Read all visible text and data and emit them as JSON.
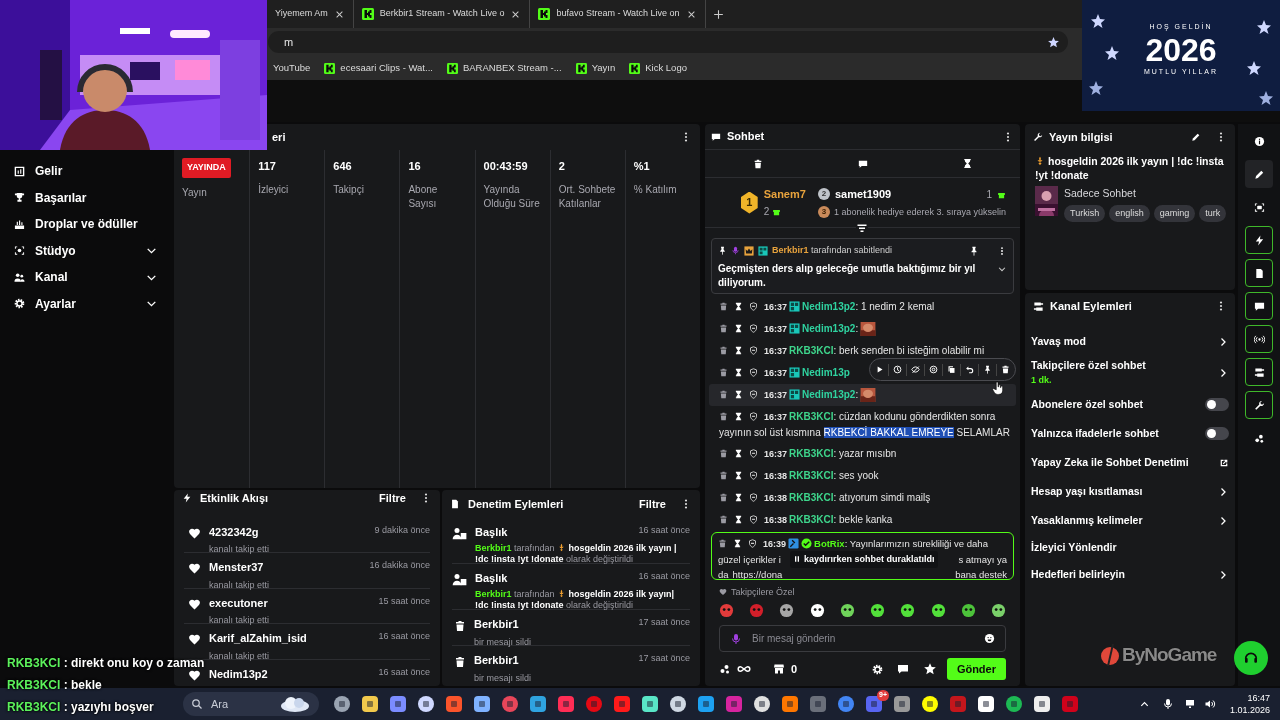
{
  "browser": {
    "tabs": [
      {
        "label": "Yiyemem Am"
      },
      {
        "label": "Berkbir1 Stream - Watch Live o"
      },
      {
        "label": "bufavo Stream - Watch Live on"
      }
    ],
    "address": "m",
    "bookmarks": [
      "YouTube",
      "ecesaari Clips - Wat...",
      "BARANBEX Stream -...",
      "Yayın",
      "Kick Logo"
    ]
  },
  "new_year_banner": {
    "top": "HOŞ GELDİN",
    "year": "2026",
    "bottom": "MUTLU YILLAR"
  },
  "sidebar": {
    "items": [
      {
        "label": "Gelir",
        "kind": "link"
      },
      {
        "label": "Başarılar",
        "kind": "link"
      },
      {
        "label": "Droplar ve ödüller",
        "kind": "link"
      },
      {
        "label": "Stüdyo",
        "kind": "group",
        "expanded": false
      },
      {
        "label": "Kanal",
        "kind": "group",
        "expanded": false
      },
      {
        "label": "Ayarlar",
        "kind": "group",
        "expanded": false
      }
    ]
  },
  "stats_panel": {
    "title": "eri",
    "stats": [
      {
        "kind": "badge",
        "value": "YAYINDA",
        "label": "Yayın"
      },
      {
        "kind": "number",
        "value": "117",
        "label": "İzleyici"
      },
      {
        "kind": "number",
        "value": "646",
        "label": "Takipçi"
      },
      {
        "kind": "number",
        "value": "16",
        "label": "Abone Sayısı"
      },
      {
        "kind": "number",
        "value": "00:43:59",
        "label": "Yayında Olduğu Süre"
      },
      {
        "kind": "number",
        "value": "2",
        "label": "Ort. Sohbete Katılanlar"
      },
      {
        "kind": "number",
        "value": "%1",
        "label": "% Katılım"
      }
    ]
  },
  "activity": {
    "title": "Etkinlik Akışı",
    "filter": "Filtre",
    "items": [
      {
        "user": "4232342g",
        "time": "9 dakika önce",
        "action": "kanalı takip etti"
      },
      {
        "user": "Menster37",
        "time": "16 dakika önce",
        "action": "kanalı takip etti"
      },
      {
        "user": "executoner",
        "time": "15 saat önce",
        "action": "kanalı takip etti"
      },
      {
        "user": "Karif_alZahim_isid",
        "time": "16 saat önce",
        "action": "kanalı takip etti"
      },
      {
        "user": "Nedim13p2",
        "time": "16 saat önce"
      }
    ]
  },
  "moderation": {
    "title": "Denetim Eylemleri",
    "filter": "Filtre",
    "items": [
      {
        "kind": "title_change",
        "title": "Başlık",
        "time": "16 saat önce",
        "user": "Berkbir1",
        "by": "tarafından",
        "value": "hosgeldin 2026 ilk yayın | !dc !insta !yt !donate",
        "suffix": "olarak değiştirildi"
      },
      {
        "kind": "title_change",
        "title": "Başlık",
        "time": "16 saat önce",
        "user": "Berkbir1",
        "by": "tarafından",
        "value": "hosgeldin 2026 ilk yayın| !dc !insta !yt !donate",
        "suffix": "olarak değiştirildi"
      },
      {
        "kind": "delete",
        "title": "Berkbir1",
        "time": "17 saat önce",
        "detail": "bir mesajı sildi"
      },
      {
        "kind": "delete",
        "title": "Berkbir1",
        "time": "17 saat önce",
        "detail": "bir mesajı sildi"
      }
    ]
  },
  "chat": {
    "title": "Sohbet",
    "leaderboard": [
      {
        "rank": "1",
        "user": "Sanem7",
        "count": "2"
      },
      {
        "rank": "2",
        "user": "samet1909",
        "count": "1"
      },
      {
        "rank": "3",
        "text": "1 abonelik hediye ederek 3. sıraya yükselin"
      }
    ],
    "pinned": {
      "user": "Berkbir1",
      "by": "tarafından sabitlendi",
      "text": "Geçmişten ders alıp geleceğe umutla baktığımız bir yıl diliyorum."
    },
    "messages": [
      {
        "kind": "text",
        "time": "16:37",
        "user": "Nedim13p2",
        "color": "#2fd3a0",
        "badge": true,
        "text": ": 1 nedim 2 kemal",
        "hovered": false,
        "show_actions": false
      },
      {
        "kind": "emote",
        "time": "16:37",
        "user": "Nedim13p2",
        "color": "#2fd3a0",
        "badge": true,
        "text": ":",
        "hovered": false,
        "show_actions": false
      },
      {
        "kind": "text",
        "time": "16:37",
        "user": "RKB3KCI",
        "color": "#3ed68c",
        "badge": false,
        "text": ": berk senden bi isteğim olabilir mi",
        "hovered": false,
        "show_actions": false
      },
      {
        "kind": "name_only",
        "time": "16:37",
        "user": "Nedim13p",
        "color": "#2fd3a0",
        "badge": true,
        "hovered": false,
        "show_actions": true
      },
      {
        "kind": "emote",
        "time": "16:37",
        "user": "Nedim13p2",
        "color": "#2fd3a0",
        "badge": true,
        "text": ":",
        "hovered": true,
        "show_actions": false
      },
      {
        "kind": "selection",
        "time": "16:37",
        "user": "RKB3KCI",
        "color": "#3ed68c",
        "badge": false,
        "text": ": cüzdan kodunu gönderdikten sonra",
        "text_2": "yayının sol üst kısmına ",
        "highlighted_text": "RKBEKCİ BAKKAL EMREYE",
        "after": " SELAMLAR",
        "hovered": false,
        "show_actions": false
      },
      {
        "kind": "text",
        "time": "16:37",
        "user": "RKB3KCI",
        "color": "#3ed68c",
        "badge": false,
        "text": ": yazar mısıbn",
        "hovered": false,
        "show_actions": false
      },
      {
        "kind": "text",
        "time": "16:38",
        "user": "RKB3KCI",
        "color": "#3ed68c",
        "badge": false,
        "text": ": ses yook",
        "hovered": false,
        "show_actions": false
      },
      {
        "kind": "text",
        "time": "16:38",
        "user": "RKB3KCI",
        "color": "#3ed68c",
        "badge": false,
        "text": ": atıyorum simdi mailş",
        "hovered": false,
        "show_actions": false
      },
      {
        "kind": "text",
        "time": "16:38",
        "user": "RKB3KCI",
        "color": "#3ed68c",
        "badge": false,
        "text": ": bekle kanka",
        "hovered": false,
        "show_actions": false
      }
    ],
    "bot_message": {
      "time": "16:39",
      "user": "BotRix",
      "color": "#53fc18",
      "parts": [
        ": Yayınlarımızın sürekliliği ve daha",
        "güzel içerikler i",
        "s atmayı ya",
        "da"
      ],
      "link": "https://dona",
      "tail": "bana destek"
    },
    "paused_notice": "kaydırırken sohbet duraklatıldı",
    "emote_label": "Takipçilere Özel",
    "input": {
      "placeholder": "Bir mesaj gönderin"
    },
    "points": "0",
    "send": "Gönder"
  },
  "stream_info": {
    "title": "Yayın bilgisi",
    "stream_title": "hosgeldin 2026 ilk yayın | !dc !insta !yt !donate",
    "category": "Sadece Sohbet",
    "tags": [
      "Turkish",
      "english",
      "gaming",
      "turk"
    ]
  },
  "channel_actions": {
    "title": "Kanal Eylemleri",
    "items": [
      {
        "kind": "arrow",
        "label": "Yavaş mod"
      },
      {
        "kind": "arrow",
        "label": "Takipçilere özel sohbet",
        "sub": "1 dk."
      },
      {
        "kind": "toggle",
        "label": "Abonelere özel sohbet",
        "on": false
      },
      {
        "kind": "toggle",
        "label": "Yalnızca ifadelerle sohbet",
        "on": false
      },
      {
        "kind": "external",
        "label": "Yapay Zeka ile Sohbet Denetimi"
      },
      {
        "kind": "arrow",
        "label": "Hesap yaşı kısıtlaması"
      },
      {
        "kind": "arrow",
        "label": "Yasaklanmış kelimeler"
      },
      {
        "kind": "plain",
        "label": "İzleyici Yönlendir"
      },
      {
        "kind": "arrow",
        "label": "Hedefleri belirleyin"
      }
    ]
  },
  "rail": [
    {
      "selected": false,
      "pinned": false
    },
    {
      "selected": true,
      "pinned": false
    },
    {
      "selected": false,
      "pinned": false
    },
    {
      "selected": false,
      "pinned": true
    },
    {
      "selected": false,
      "pinned": true
    },
    {
      "selected": false,
      "pinned": true
    },
    {
      "selected": false,
      "pinned": true
    },
    {
      "selected": false,
      "pinned": true
    },
    {
      "selected": false,
      "pinned": true
    },
    {
      "selected": false,
      "pinned": false
    }
  ],
  "overlay_chat": [
    {
      "user": "RKB3KCI",
      "text": ": direkt onu koy o zaman"
    },
    {
      "user": "RKB3KCI",
      "text": ": bekle"
    },
    {
      "user": "RKB3KCI",
      "text": ": yazıyhı boşver"
    }
  ],
  "sponsor_logo": "ByNoGame",
  "taskbar": {
    "search": "Ara",
    "badge": "9+",
    "time": "16:47",
    "date": "1.01.2026"
  }
}
